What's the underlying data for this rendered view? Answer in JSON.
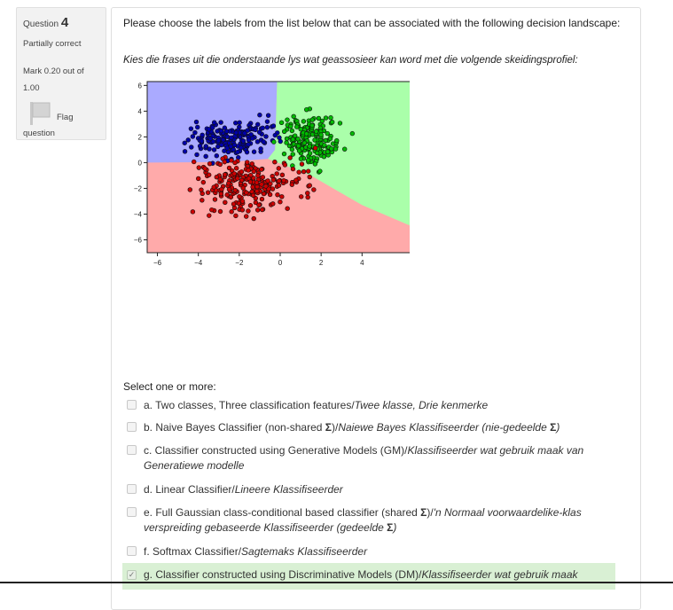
{
  "info": {
    "question_label": "Question",
    "question_number": "4",
    "state": "Partially correct",
    "mark_line1": "Mark 0.20 out of",
    "mark_line2": "1.00",
    "flag_line1": "Flag",
    "flag_line2": "question"
  },
  "question": {
    "text_en": "Please choose the labels from the list below that can be associated with the following decision landscape:",
    "text_af": "Kies die frases uit die onderstaande lys wat geassosieer kan word met die volgende skeidingsprofiel:"
  },
  "chart_data": {
    "type": "scatter",
    "title": "",
    "xlabel": "",
    "ylabel": "",
    "xlim": [
      -6.5,
      6.5
    ],
    "ylim": [
      -7.0,
      6.3
    ],
    "x_ticks": [
      "−6",
      "−4",
      "−2",
      "0",
      "2",
      "4"
    ],
    "y_ticks": [
      "6",
      "4",
      "2",
      "0",
      "−2",
      "−4",
      "−6"
    ],
    "regions": [
      {
        "class": "blue",
        "color": "#aaaaff"
      },
      {
        "class": "green",
        "color": "#aaffaa"
      },
      {
        "class": "red",
        "color": "#ffaaaa"
      }
    ],
    "series": [
      {
        "class": "blue",
        "color": "#0000aa",
        "center": [
          -2.3,
          2.0
        ],
        "spread": [
          1.4,
          1.0
        ],
        "count": 180
      },
      {
        "class": "green",
        "color": "#00bb00",
        "center": [
          1.5,
          1.8
        ],
        "spread": [
          1.0,
          1.3
        ],
        "count": 180
      },
      {
        "class": "red",
        "color": "#cc0000",
        "center": [
          -1.5,
          -1.7
        ],
        "spread": [
          1.7,
          1.5
        ],
        "count": 230
      }
    ]
  },
  "options": {
    "prompt": "Select one or more:",
    "items": [
      {
        "en": "a. Two classes, Three classification features/",
        "af": "Twee klasse, Drie kenmerke",
        "checked": false
      },
      {
        "en": "b. Naive Bayes Classifier (non-shared ",
        "sigma": "Σ",
        "en2": ")/",
        "af": "Naiewe Bayes Klassifiseerder (nie-gedeelde ",
        "af_sigma": "Σ",
        "af2": ")",
        "checked": false
      },
      {
        "en": "c. Classifier constructed using Generative Models (GM)/",
        "af": "Klassifiseerder wat gebruik maak van Generatiewe modelle",
        "checked": false
      },
      {
        "en": "d. Linear Classifier/",
        "af": "Lineere Klassifiseerder",
        "checked": false
      },
      {
        "en": "e. Full Gaussian class-conditional based classifier (shared ",
        "sigma": "Σ",
        "en2": ")/",
        "af": "'n Normaal voorwaardelike-klas verspreiding gebaseerde Klassifiseerder (gedeelde ",
        "af_sigma": "Σ",
        "af2": ")",
        "checked": false
      },
      {
        "en": "f. Softmax Classifier/",
        "af": "Sagtemaks Klassifiseerder",
        "checked": false
      },
      {
        "en": "g. Classifier constructed using Discriminative Models (DM)/",
        "af": "Klassifiseerder wat gebruik maak",
        "checked": true
      }
    ]
  }
}
